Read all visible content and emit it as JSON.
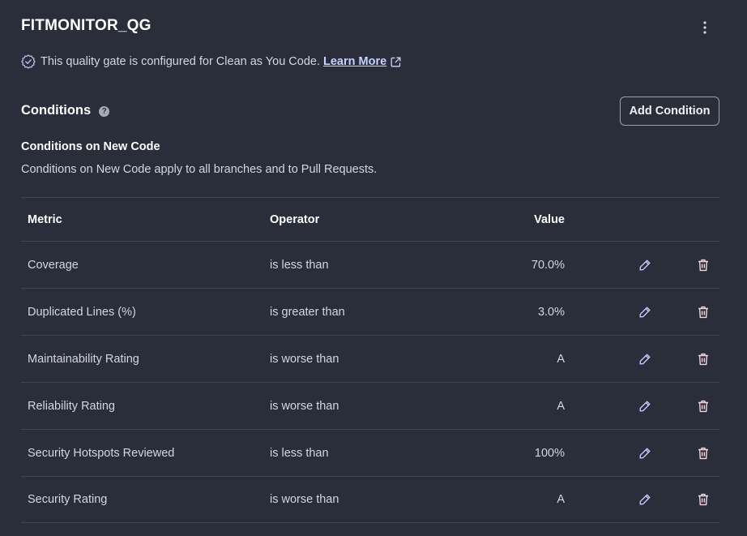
{
  "gate": {
    "name": "FITMONITOR_QG",
    "menu_icon": "kebab-icon",
    "cayc_text": "This quality gate is configured for Clean as You Code.",
    "learn_more": "Learn More"
  },
  "conditions": {
    "title": "Conditions",
    "add_button": "Add Condition",
    "new_code_title": "Conditions on New Code",
    "new_code_desc": "Conditions on New Code apply to all branches and to Pull Requests.",
    "columns": {
      "metric": "Metric",
      "operator": "Operator",
      "value": "Value"
    },
    "rows": [
      {
        "metric": "Coverage",
        "operator": "is less than",
        "value": "70.0%"
      },
      {
        "metric": "Duplicated Lines (%)",
        "operator": "is greater than",
        "value": "3.0%"
      },
      {
        "metric": "Maintainability Rating",
        "operator": "is worse than",
        "value": "A"
      },
      {
        "metric": "Reliability Rating",
        "operator": "is worse than",
        "value": "A"
      },
      {
        "metric": "Security Hotspots Reviewed",
        "operator": "is less than",
        "value": "100%"
      },
      {
        "metric": "Security Rating",
        "operator": "is worse than",
        "value": "A"
      }
    ]
  },
  "colors": {
    "background": "#2a2d3a",
    "link": "#c9d3ff",
    "edit_icon": "#c5c9ff",
    "delete_icon": "#f4d6dc"
  }
}
